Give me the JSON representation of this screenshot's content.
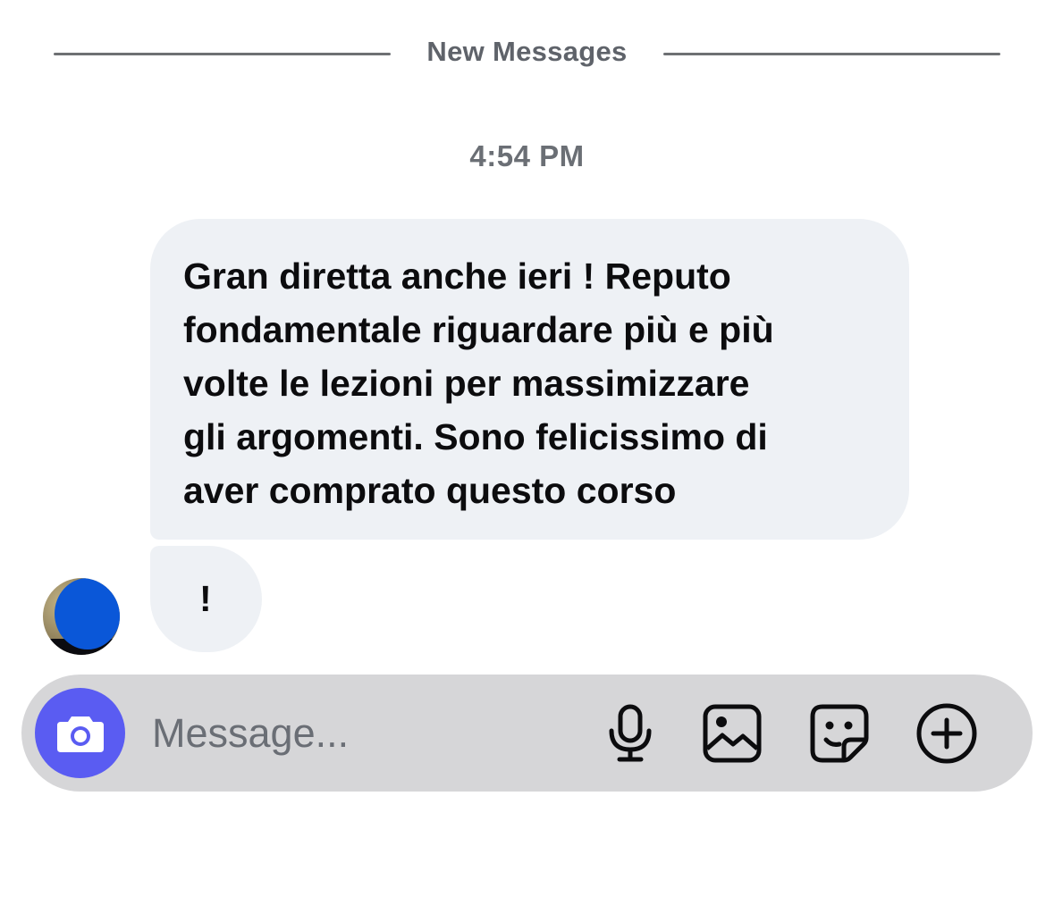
{
  "divider": {
    "label": "New Messages"
  },
  "timestamp": "4:54 PM",
  "messages": [
    {
      "lines": [
        "Gran diretta anche ieri ! Reputo",
        "fondamentale riguardare più e più",
        "volte le lezioni per massimizzare",
        "gli argomenti. Sono felicissimo di",
        "aver comprato questo corso"
      ]
    },
    {
      "text": "!"
    }
  ],
  "composer": {
    "placeholder": "Message...",
    "accent_color": "#5a5cf2",
    "icons": [
      "camera-icon",
      "microphone-icon",
      "gallery-icon",
      "sticker-icon",
      "plus-circle-icon"
    ]
  },
  "colors": {
    "bubble_background": "#eef1f5",
    "composer_background": "#d6d6d8",
    "secondary_text": "#6b6f75"
  }
}
